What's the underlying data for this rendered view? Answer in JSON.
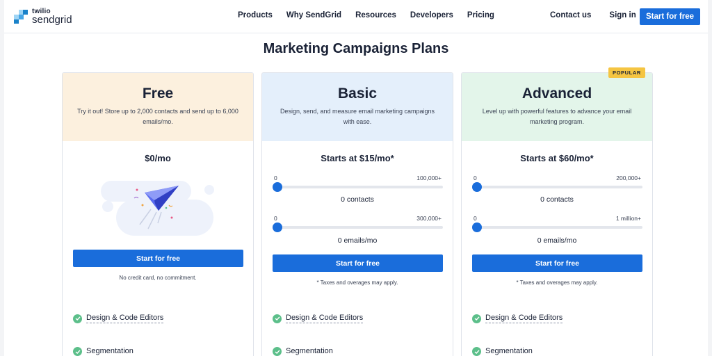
{
  "brand": {
    "line1": "twilio",
    "line2": "sendgrid"
  },
  "nav": {
    "links": [
      "Products",
      "Why SendGrid",
      "Resources",
      "Developers",
      "Pricing"
    ],
    "contact": "Contact us",
    "signin": "Sign in",
    "cta": "Start for free"
  },
  "page_title": "Marketing Campaigns Plans",
  "colors": {
    "accent": "#1a6ddb",
    "free_header": "#fcf0de",
    "basic_header": "#e4effb",
    "advanced_header": "#e3f5ea",
    "check": "#5cbf8a",
    "badge": "#f5c542"
  },
  "plans": [
    {
      "name": "Free",
      "desc": "Try it out! Store up to 2,000 contacts and send up to 6,000 emails/mo.",
      "price": "$0/mo",
      "cta": "Start for free",
      "note": "No credit card, no commitment.",
      "features": [
        "Design & Code Editors",
        "Segmentation"
      ],
      "icon": "paper-plane-illustration"
    },
    {
      "name": "Basic",
      "desc": "Design, send, and measure email marketing campaigns with ease.",
      "price": "Starts at $15/mo*",
      "contacts_slider": {
        "min": "0",
        "max": "100,000+",
        "value_label": "0 contacts",
        "level": 0
      },
      "emails_slider": {
        "min": "0",
        "max": "300,000+",
        "value_label": "0 emails/mo",
        "level": 0
      },
      "cta": "Start for free",
      "note": "* Taxes and overages may apply.",
      "features": [
        "Design & Code Editors",
        "Segmentation"
      ]
    },
    {
      "name": "Advanced",
      "badge": "POPULAR",
      "desc": "Level up with powerful features to advance your email marketing program.",
      "price": "Starts at $60/mo*",
      "contacts_slider": {
        "min": "0",
        "max": "200,000+",
        "value_label": "0 contacts",
        "level": 0
      },
      "emails_slider": {
        "min": "0",
        "max": "1 million+",
        "value_label": "0 emails/mo",
        "level": 0
      },
      "cta": "Start for free",
      "note": "* Taxes and overages may apply.",
      "features": [
        "Design & Code Editors",
        "Segmentation"
      ]
    }
  ]
}
